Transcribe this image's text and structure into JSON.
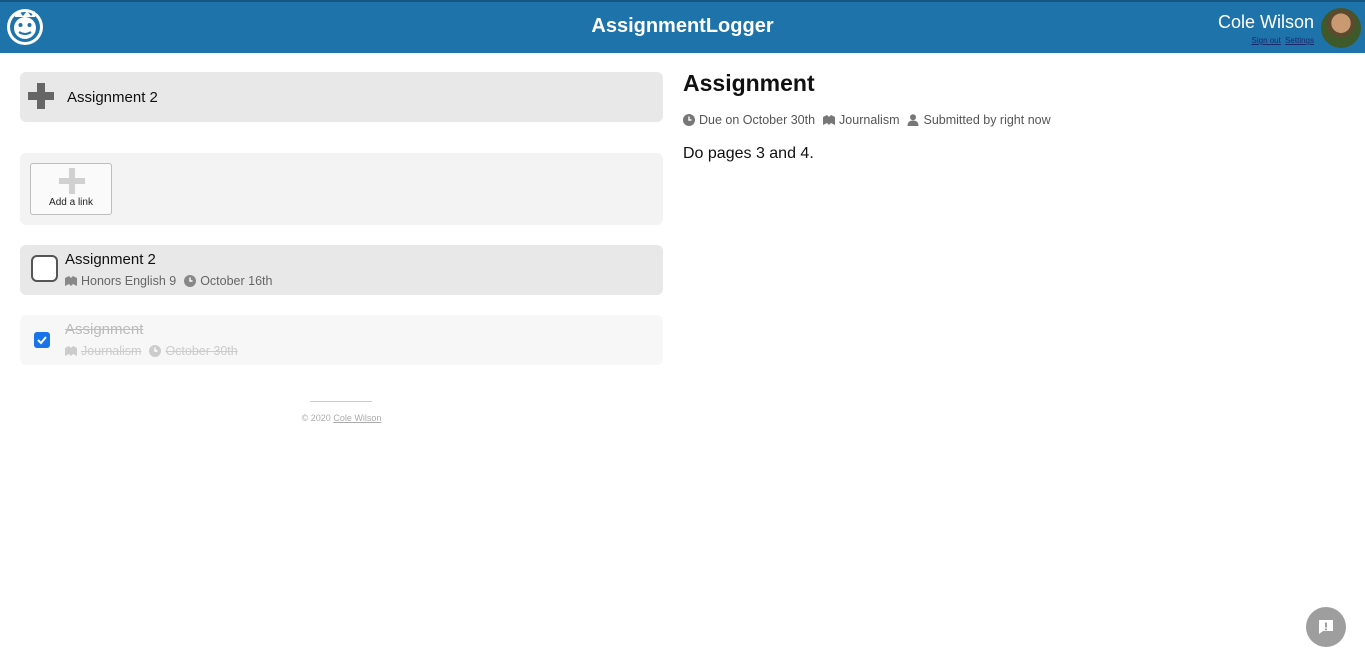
{
  "header": {
    "app_title": "AssignmentLogger",
    "user_name": "Cole Wilson",
    "sign_out_label": "Sign out",
    "settings_label": "Settings",
    "brand_color": "#1e73ab"
  },
  "new_assignment": {
    "title_value": "Assignment 2"
  },
  "links": {
    "add_link_label": "Add a link"
  },
  "assignments": [
    {
      "title": "Assignment 2",
      "course": "Honors English 9",
      "due": "October 16th",
      "done": false
    },
    {
      "title": "Assignment",
      "course": "Journalism",
      "due": "October 30th",
      "done": true
    }
  ],
  "footer": {
    "copyright": "© 2020",
    "author_link": "Cole Wilson"
  },
  "detail": {
    "title": "Assignment",
    "due_text": "Due on October 30th",
    "course": "Journalism",
    "submitted_text": "Submitted by right now",
    "body": "Do pages 3 and 4."
  },
  "icons": {
    "clock": "clock-icon",
    "course": "book-icon",
    "user": "user-icon",
    "plus": "plus-icon",
    "feedback": "feedback-icon"
  }
}
